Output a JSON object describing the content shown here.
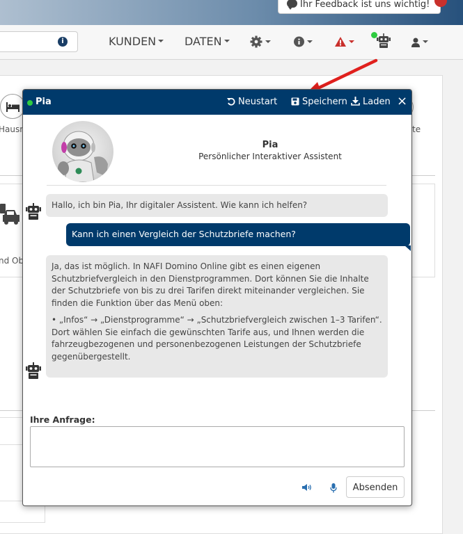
{
  "topbar": {
    "feedback_label": "Ihr Feedback ist uns wichtig!"
  },
  "nav": {
    "kunden": "KUNDEN",
    "daten": "DATEN"
  },
  "background": {
    "label_hausrat": "Hausra",
    "label_right": "te",
    "label_obj": "nd Ob"
  },
  "chat": {
    "header": {
      "name": "Pia",
      "restart_label": "Neustart",
      "save_label": "Speichern",
      "load_label": "Laden",
      "close_label": "×"
    },
    "profile": {
      "name": "Pia",
      "subtitle": "Persönlicher Interaktiver Assistent"
    },
    "messages": [
      {
        "from": "bot",
        "text": "Hallo, ich bin Pia, Ihr digitaler Assistent. Wie kann ich helfen?"
      },
      {
        "from": "user",
        "text": "Kann ich einen Vergleich der Schutzbriefe machen?"
      },
      {
        "from": "bot",
        "para1": "Ja, das ist möglich. In NAFI Domino Online gibt es einen eigenen Schutzbriefvergleich in den Dienstprogrammen. Dort können Sie die Inhalte der Schutzbriefe von bis zu drei Tarifen direkt miteinander vergleichen. Sie finden die Funktion über das Menü oben:",
        "para2": "• „Infos“ → „Dienstprogramme“ → „Schutzbriefvergleich zwischen 1–3 Tarifen“.",
        "para3": "Dort wählen Sie einfach die gewünschten Tarife aus, und Ihnen werden die fahrzeugbezogenen und personenbezogenen Leistungen der Schutzbriefe gegenübergestellt."
      }
    ],
    "input": {
      "label": "Ihre Anfrage:",
      "value": ""
    },
    "send_label": "Absenden"
  },
  "colors": {
    "header_bg": "#003a6b",
    "user_bubble": "#003a6b",
    "bot_bubble": "#e8e8e8",
    "online": "#2ecc40",
    "alert": "#c9302c"
  }
}
